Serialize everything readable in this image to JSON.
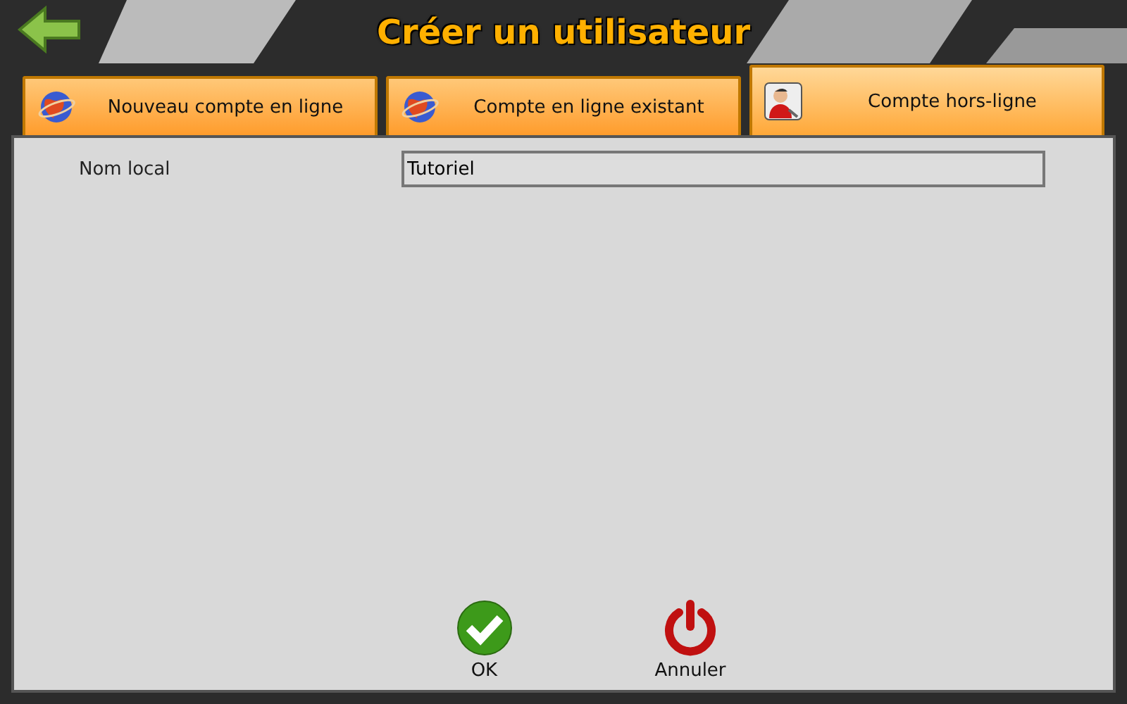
{
  "header": {
    "title": "Créer un utilisateur"
  },
  "tabs": [
    {
      "label": "Nouveau compte en ligne",
      "kind": "online",
      "selected": false
    },
    {
      "label": "Compte en ligne existant",
      "kind": "online",
      "selected": false
    },
    {
      "label": "Compte hors-ligne",
      "kind": "offline",
      "selected": true
    }
  ],
  "form": {
    "fields": [
      {
        "label": "Nom local",
        "value": "Tutoriel"
      }
    ]
  },
  "buttons": [
    {
      "label": "OK",
      "kind": "ok"
    },
    {
      "label": "Annuler",
      "kind": "cancel"
    }
  ]
}
